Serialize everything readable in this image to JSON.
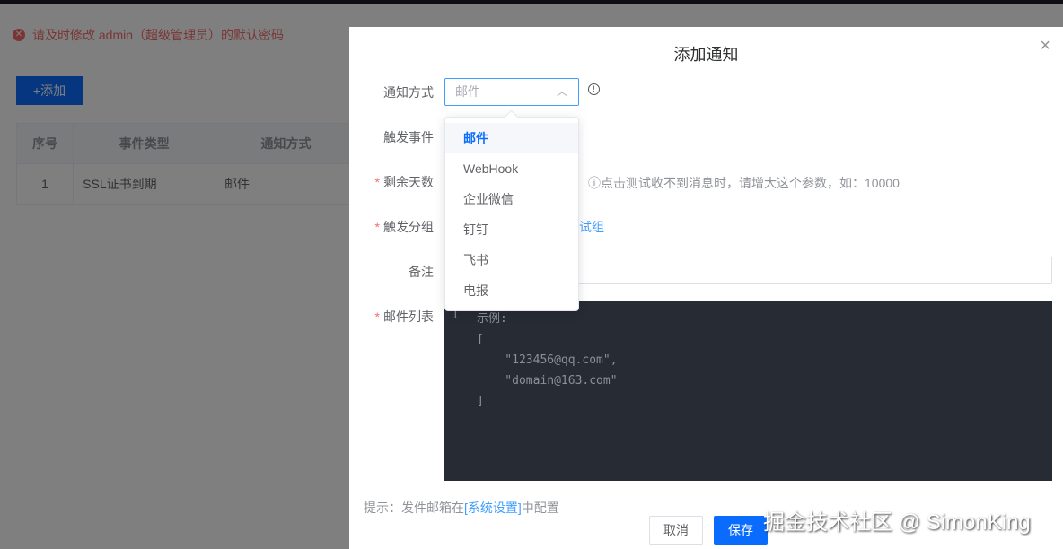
{
  "alert": "请及时修改 admin（超级管理员）的默认密码",
  "add_button": "+添加",
  "table": {
    "headers": [
      "序号",
      "事件类型",
      "通知方式"
    ],
    "rows": [
      [
        "1",
        "SSL证书到期",
        "邮件"
      ]
    ]
  },
  "modal": {
    "title": "添加通知",
    "labels": {
      "method": "通知方式",
      "event": "触发事件",
      "days": "剩余天数",
      "group": "触发分组",
      "remark": "备注",
      "email_list": "邮件列表"
    },
    "method_value": "邮件",
    "days_hint": "ⓘ点击测试收不到消息时，请增大这个参数，如：10000",
    "group_value": "试组",
    "editor": {
      "line_number": "1",
      "code": "示例:\n[\n    \"123456@qq.com\",\n    \"domain@163.com\"\n]"
    },
    "tip_prefix": "提示：发件邮箱在",
    "tip_link": "[系统设置]",
    "tip_suffix": "中配置",
    "cancel": "取消",
    "save": "保存"
  },
  "dropdown": {
    "options": [
      "邮件",
      "WebHook",
      "企业微信",
      "钉钉",
      "飞书",
      "电报"
    ],
    "selected": "邮件"
  },
  "watermark": "掘金技术社区 @ SimonKing",
  "colors": {
    "primary": "#0a6cff",
    "danger": "#f56c6c"
  }
}
